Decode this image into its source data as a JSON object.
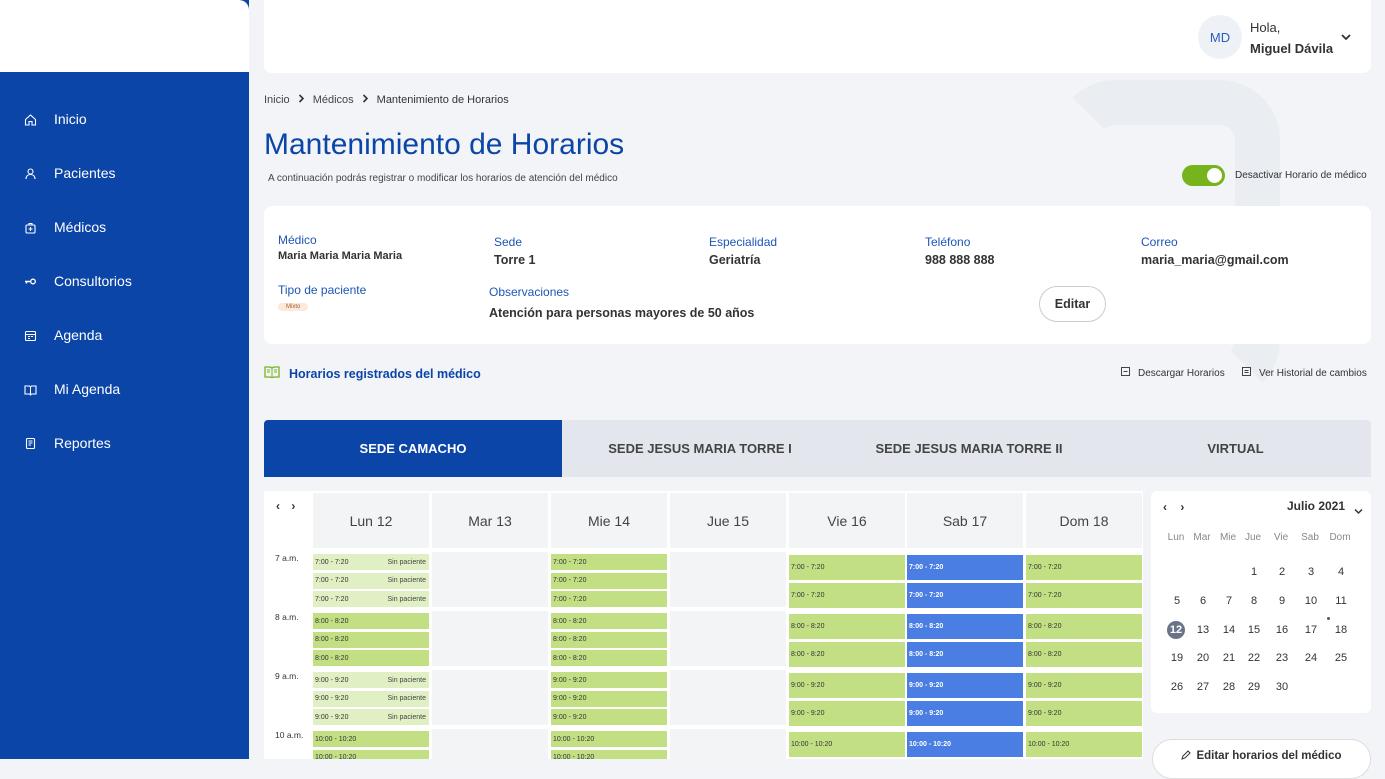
{
  "sidebar": {
    "items": [
      {
        "label": "Inicio",
        "icon": "home-icon"
      },
      {
        "label": "Pacientes",
        "icon": "patients-icon"
      },
      {
        "label": "Médicos",
        "icon": "doctors-icon"
      },
      {
        "label": "Consultorios",
        "icon": "key-icon"
      },
      {
        "label": "Agenda",
        "icon": "calendar-icon"
      },
      {
        "label": "Mi Agenda",
        "icon": "book-icon"
      },
      {
        "label": "Reportes",
        "icon": "report-icon"
      }
    ]
  },
  "user": {
    "initials": "MD",
    "greeting": "Hola,",
    "name": "Miguel Dávila"
  },
  "breadcrumb": [
    "Inicio",
    "Médicos",
    "Mantenimiento de Horarios"
  ],
  "page": {
    "title": "Mantenimiento de Horarios",
    "subtitle": "A continuación podrás registrar o modificar los horarios de atención del médico",
    "toggle_label": "Desactivar Horario de médico",
    "toggle_on": true
  },
  "info": {
    "medico_label": "Médico",
    "medico": "Maria Maria Maria Maria",
    "sede_label": "Sede",
    "sede": "Torre 1",
    "especialidad_label": "Especialidad",
    "especialidad": "Geriatría",
    "telefono_label": "Teléfono",
    "telefono": "988 888 888",
    "correo_label": "Correo",
    "correo": "maria_maria@gmail.com",
    "tipo_label": "Tipo de paciente",
    "tipo": "Mixto",
    "obs_label": "Observaciones",
    "obs": "Atención para personas mayores de 50 años",
    "edit_label": "Editar"
  },
  "section": {
    "title": "Horarios registrados del médico",
    "download": "Descargar Horarios",
    "history": "Ver Historial de cambios"
  },
  "tabs": [
    "SEDE CAMACHO",
    "SEDE JESUS MARIA TORRE I",
    "SEDE JESUS MARIA TORRE II",
    "VIRTUAL"
  ],
  "schedule": {
    "nav": "‹ ›",
    "days": [
      "Lun 12",
      "Mar 13",
      "Mie 14",
      "Jue 15",
      "Vie 16",
      "Sab 17",
      "Dom 18"
    ],
    "hours": [
      "7 a.m.",
      "8 a.m.",
      "9 a.m.",
      "10 a.m."
    ],
    "no_patient": "Sin paciente",
    "slot_labels": {
      "h7": [
        "7:00 - 7:20",
        "7:00 - 7:20",
        "7:00 - 7:20"
      ],
      "h8": [
        "8:00 - 8:20",
        "8:00 - 8:20",
        "8:00 - 8:20"
      ],
      "h9": [
        "9:00 - 9:20",
        "9:00 - 9:20",
        "9:00 - 9:20"
      ],
      "h10": [
        "10:00 - 10:20",
        "10:00 - 10:20"
      ]
    },
    "colors": {
      "green": "#c3df84",
      "light": "#e1f0c4",
      "blue": "#4a7ee2"
    }
  },
  "calendar": {
    "nav": "‹ ›",
    "month": "Julio 2021",
    "weekdays": [
      "Lun",
      "Mar",
      "Mie",
      "Jue",
      "Vie",
      "Sab",
      "Dom"
    ],
    "weeks": [
      [
        "",
        "",
        "",
        "1",
        "2",
        "3",
        "4"
      ],
      [
        "5",
        "6",
        "7",
        "8",
        "9",
        "10",
        "11"
      ],
      [
        "12",
        "13",
        "14",
        "15",
        "16",
        "17",
        "18"
      ],
      [
        "19",
        "20",
        "21",
        "22",
        "23",
        "24",
        "25"
      ],
      [
        "26",
        "27",
        "28",
        "29",
        "30",
        "",
        ""
      ]
    ],
    "selected": "12",
    "edit_button": "Editar horarios del médico"
  }
}
